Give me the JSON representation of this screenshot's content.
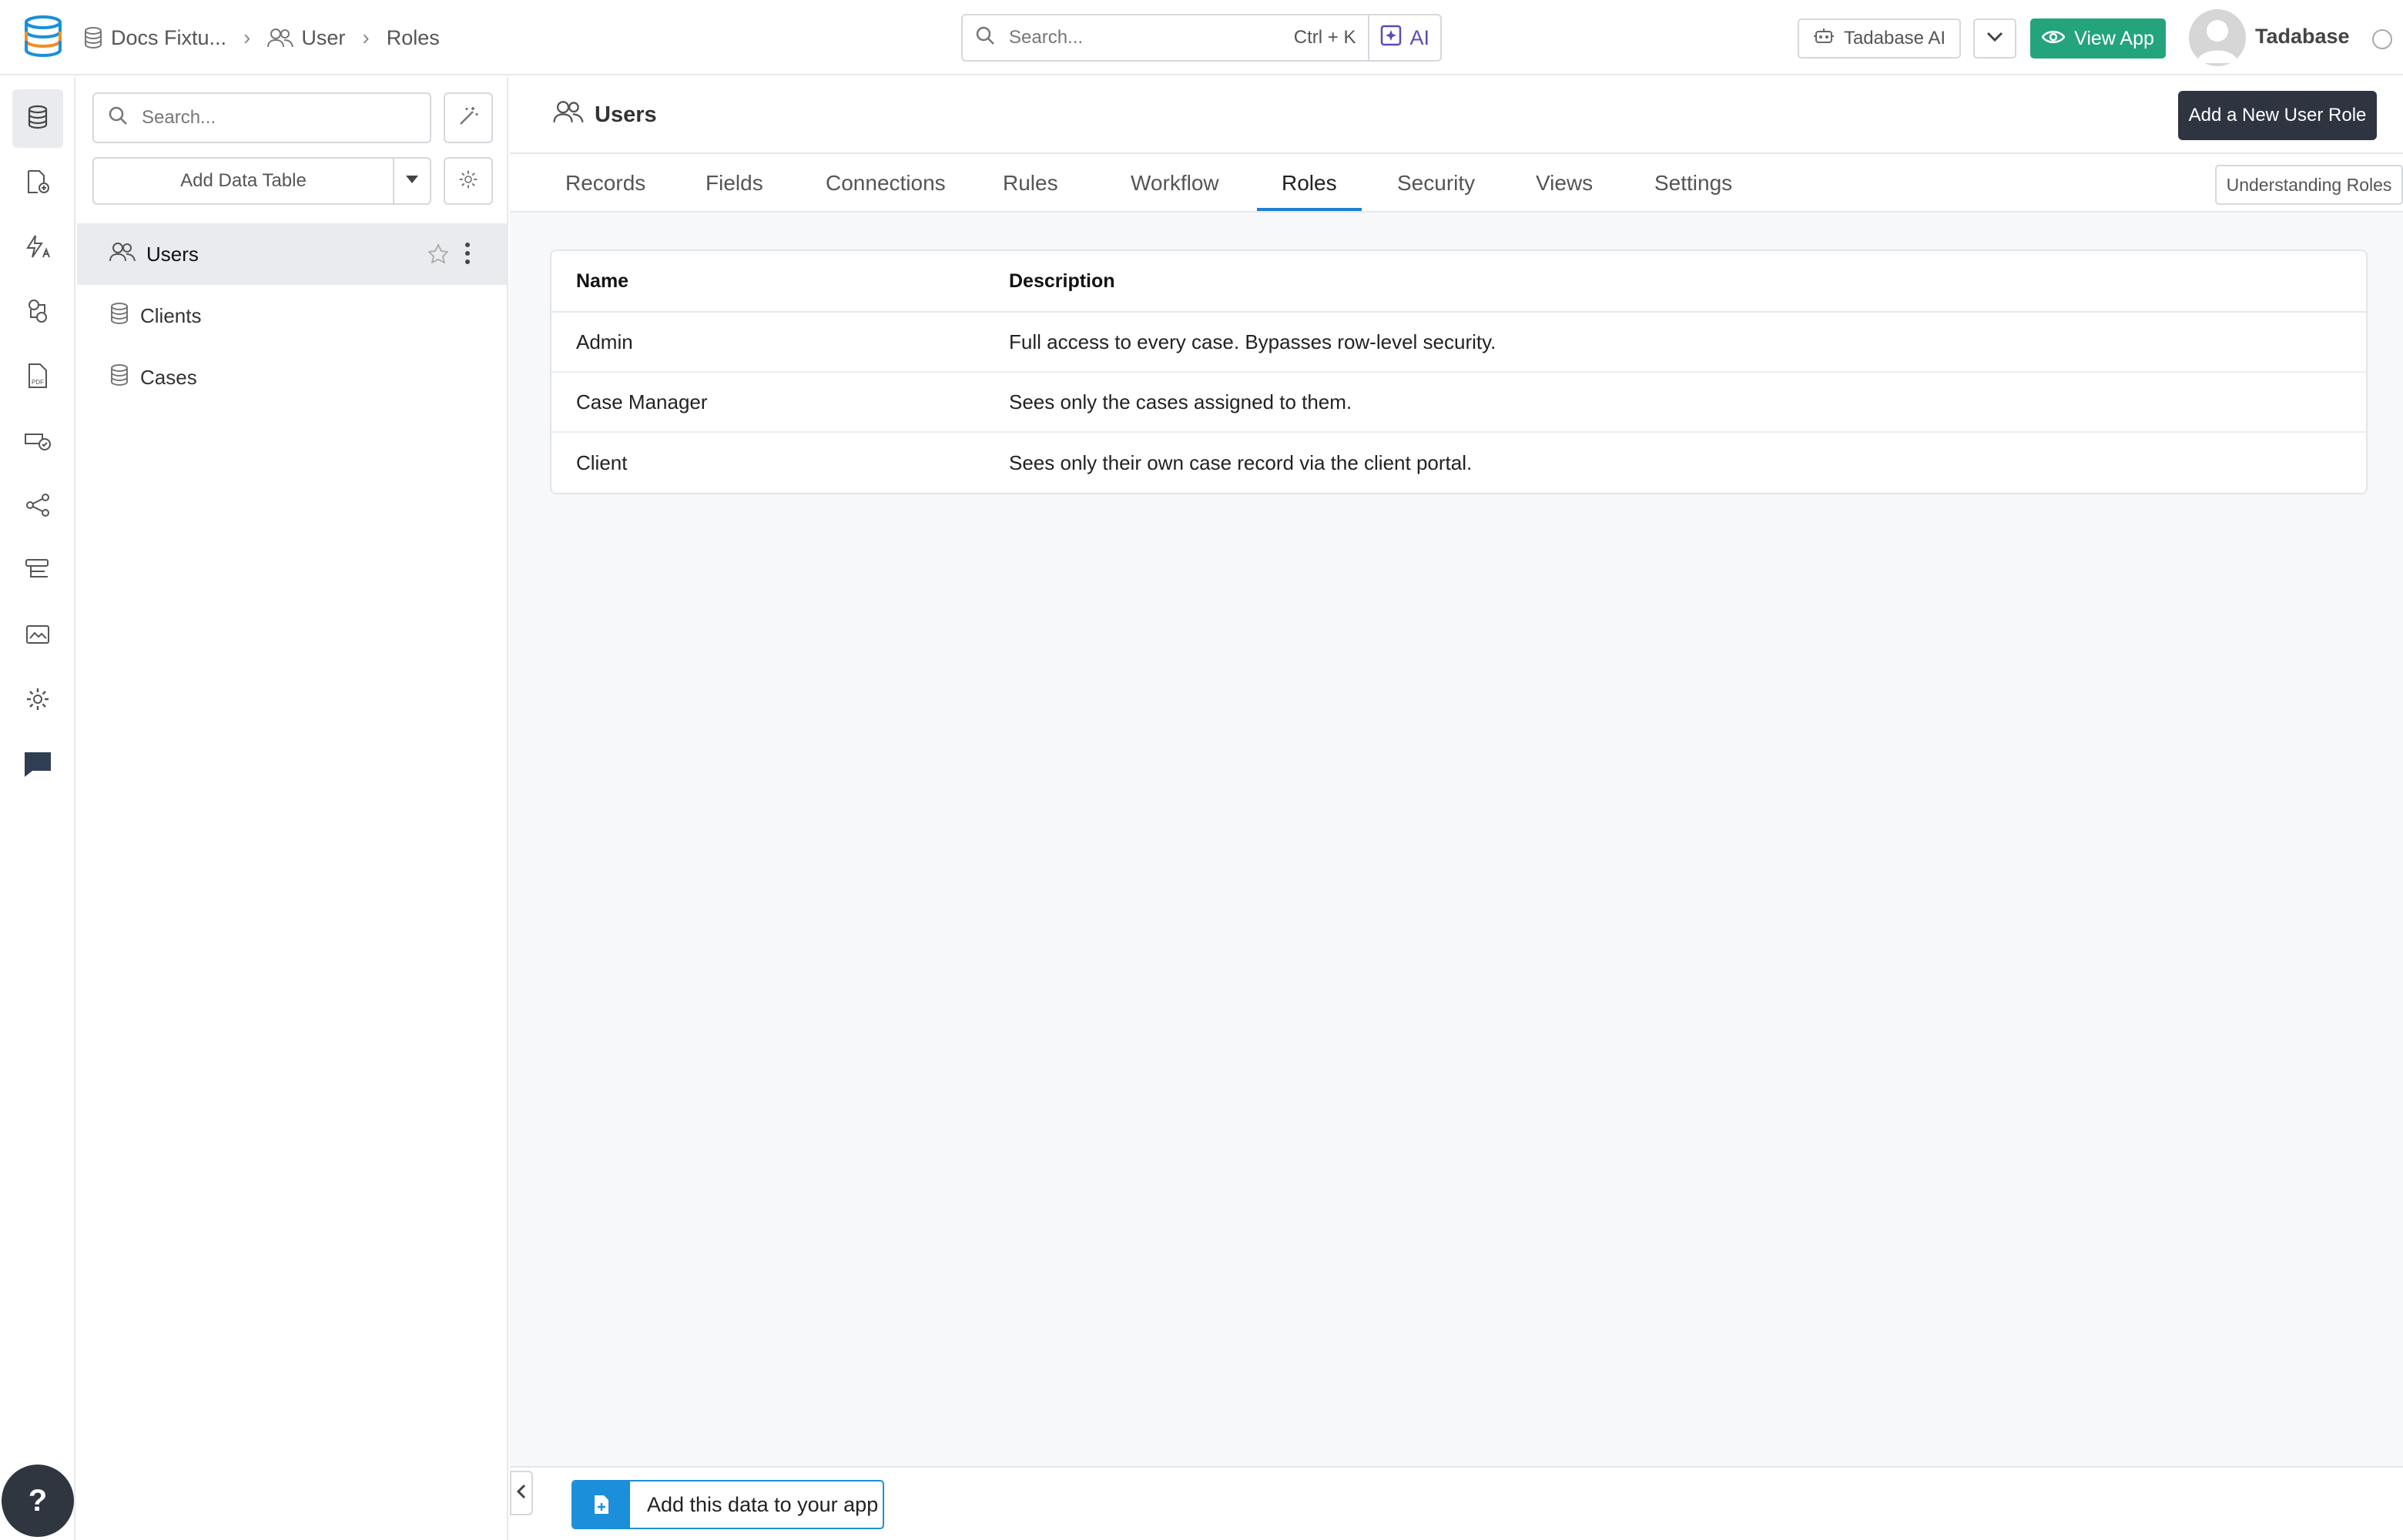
{
  "breadcrumb": [
    {
      "label": "Docs Fixtu...",
      "icon": "database-icon"
    },
    {
      "label": "User",
      "icon": "users-icon"
    },
    {
      "label": "Roles",
      "icon": ""
    }
  ],
  "global_search": {
    "placeholder": "Search...",
    "shortcut": "Ctrl + K",
    "ai_label": "AI"
  },
  "header": {
    "tadabase_ai_label": "Tadabase AI",
    "view_app_label": "View App",
    "user_name": "Tadabase"
  },
  "sidebar_search": {
    "placeholder": "Search..."
  },
  "add_table": {
    "label": "Add Data Table"
  },
  "tables": [
    {
      "label": "Users",
      "icon": "users-icon",
      "active": true
    },
    {
      "label": "Clients",
      "icon": "database-icon",
      "active": false
    },
    {
      "label": "Cases",
      "icon": "database-icon",
      "active": false
    }
  ],
  "main": {
    "title": "Users",
    "new_role_label": "Add a New User Role",
    "understanding_label": "Understanding Roles",
    "tabs": [
      "Records",
      "Fields",
      "Connections",
      "Rules",
      "Workflow",
      "Roles",
      "Security",
      "Views",
      "Settings"
    ],
    "active_tab": "Roles"
  },
  "roles_table": {
    "headers": {
      "name": "Name",
      "description": "Description"
    },
    "rows": [
      {
        "name": "Admin",
        "description": "Full access to every case. Bypasses row-level security."
      },
      {
        "name": "Case Manager",
        "description": "Sees only the cases assigned to them."
      },
      {
        "name": "Client",
        "description": "Sees only their own case record via the client portal."
      }
    ]
  },
  "footer": {
    "add_data_label": "Add this data to your app",
    "help_label": "?"
  },
  "colors": {
    "primary_green": "#24a47c",
    "accent_blue": "#1b8fd9",
    "tab_underline": "#1f7fd6",
    "dark_button": "#2e3440"
  }
}
